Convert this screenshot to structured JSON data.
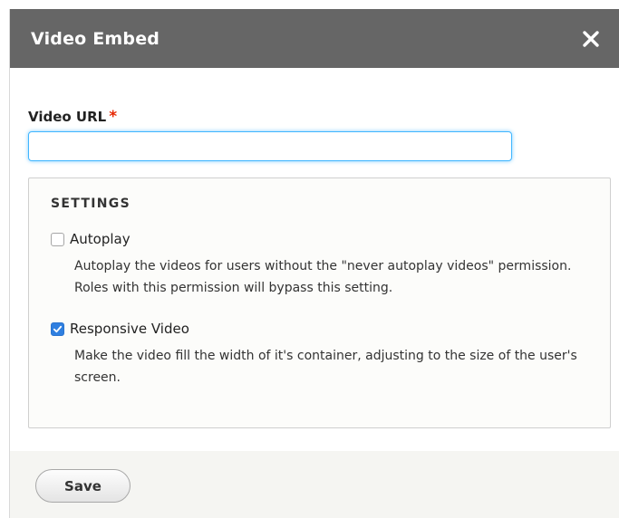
{
  "dialog": {
    "title": "Video Embed",
    "close_icon": "close-icon"
  },
  "form": {
    "url_label": "Video URL",
    "required_mark": "*",
    "url_value": "",
    "url_placeholder": ""
  },
  "settings": {
    "legend": "SETTINGS",
    "options": [
      {
        "label": "Autoplay",
        "checked": false,
        "description": "Autoplay the videos for users without the \"never autoplay videos\" permission. Roles with this permission will bypass this setting."
      },
      {
        "label": "Responsive Video",
        "checked": true,
        "description": "Make the video fill the width of it's container, adjusting to the size of the user's screen."
      }
    ]
  },
  "footer": {
    "save_label": "Save"
  },
  "colors": {
    "titlebar": "#666666",
    "focus_border": "#40b6ff",
    "required": "#e62600",
    "checkbox_checked": "#2f7fe0"
  }
}
